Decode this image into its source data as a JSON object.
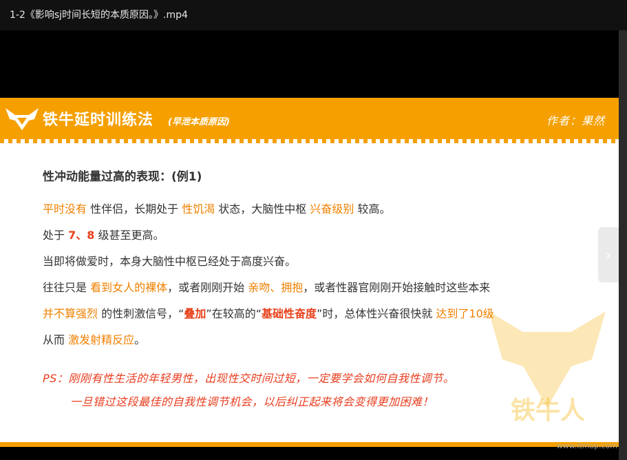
{
  "window": {
    "title": "1-2《影响sj时间长短的本质原因。》.mp4"
  },
  "slide": {
    "brand": "铁牛延时训练法",
    "brand_sub": "(早泄本质原因)",
    "author": "作者：果然",
    "heading": "性冲动能量过高的表现：(例1)",
    "lines": [
      [
        {
          "t": "平时没有",
          "s": "o"
        },
        {
          "t": " 性伴侣，长期处于 ",
          "s": ""
        },
        {
          "t": "性饥渴",
          "s": "o"
        },
        {
          "t": " 状态，大脑性中枢 ",
          "s": ""
        },
        {
          "t": "兴奋级别",
          "s": "o"
        },
        {
          "t": " 较高。",
          "s": ""
        }
      ],
      [
        {
          "t": "处于 ",
          "s": ""
        },
        {
          "t": "7、8",
          "s": "r"
        },
        {
          "t": " 级甚至更高。",
          "s": ""
        }
      ],
      [
        {
          "t": "当即将做爱时，本身大脑性中枢已经处于高度兴奋。",
          "s": ""
        }
      ],
      [
        {
          "t": "往往只是 ",
          "s": ""
        },
        {
          "t": "看到女人的裸体",
          "s": "o"
        },
        {
          "t": "，或者刚刚开始 ",
          "s": ""
        },
        {
          "t": "亲吻、拥抱",
          "s": "o"
        },
        {
          "t": "，或者性器官刚刚开始接触时这些本来",
          "s": ""
        }
      ],
      [
        {
          "t": "并不算强烈",
          "s": "o"
        },
        {
          "t": " 的性刺激信号，“",
          "s": ""
        },
        {
          "t": "叠加",
          "s": "r"
        },
        {
          "t": "”在较高的“",
          "s": ""
        },
        {
          "t": "基础性奋度",
          "s": "r"
        },
        {
          "t": "”时，总体性兴奋很快就 ",
          "s": ""
        },
        {
          "t": "达到了10级",
          "s": "o"
        }
      ],
      [
        {
          "t": "从而 ",
          "s": ""
        },
        {
          "t": "激发射精反应",
          "s": "o"
        },
        {
          "t": "。",
          "s": ""
        }
      ]
    ],
    "ps1": "PS：刚刚有性生活的年轻男性，出现性交时间过短，一定要学会如何自我性调节。",
    "ps2": "一旦错过这段最佳的自我性调节机会，以后纠正起来将会变得更加困难！",
    "watermark_text": "铁牛人"
  },
  "site": "www.ltmop.com",
  "icons": {
    "next": "chevron-right-icon",
    "logo": "bull-logo-icon"
  },
  "colors": {
    "accent": "#f5a000",
    "orange_text": "#f08000",
    "red_text": "#e8401a"
  }
}
